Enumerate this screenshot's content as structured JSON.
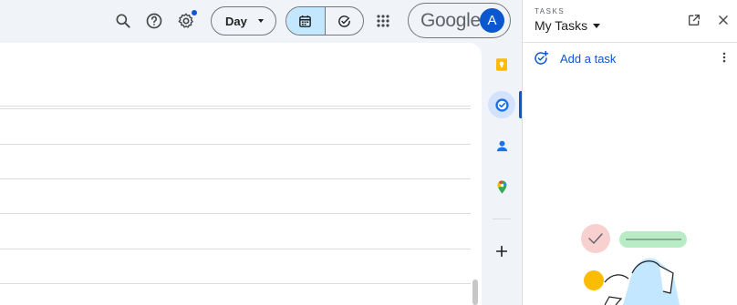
{
  "header": {
    "icons": [
      "search-icon",
      "help-icon",
      "settings-icon",
      "apps-grid-icon"
    ],
    "view_select": {
      "selected": "Day"
    },
    "view_toggle": {
      "active": "calendar",
      "options": [
        "calendar",
        "tasks"
      ]
    },
    "account": {
      "brand": "Google",
      "avatar_letter": "A",
      "avatar_color": "#0b57d0"
    }
  },
  "side_rail": {
    "items": [
      {
        "name": "keep",
        "icon": "keep-icon"
      },
      {
        "name": "tasks",
        "icon": "tasks-icon",
        "active": true
      },
      {
        "name": "contacts",
        "icon": "contacts-icon"
      },
      {
        "name": "maps",
        "icon": "maps-icon"
      },
      {
        "name": "get-add-ons",
        "icon": "plus-icon"
      }
    ]
  },
  "tasks_panel": {
    "eyebrow": "TASKS",
    "list_name": "My Tasks",
    "add_task_label": "Add a task",
    "accent": "#0b57d0"
  }
}
